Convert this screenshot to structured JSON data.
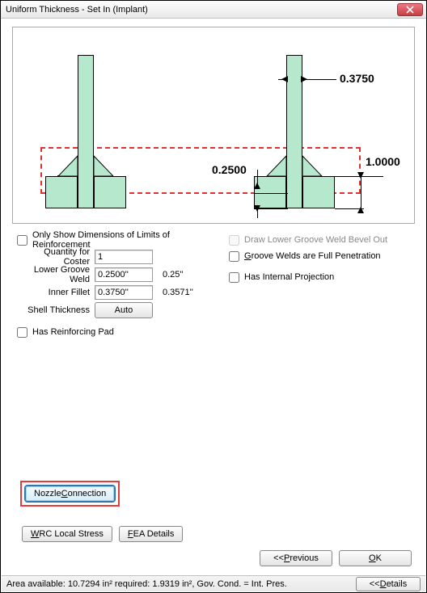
{
  "title": "Uniform Thickness - Set In (Implant)",
  "diagram": {
    "dim_top": "0.3750",
    "dim_right": "1.0000",
    "dim_mid": "0.2500"
  },
  "checkboxes": {
    "only_show_limits": "Only Show Dimensions of Limits of Reinforcement",
    "draw_lower_bevel": "Draw Lower Groove Weld Bevel Out",
    "groove_full_pen_pre": "G",
    "groove_full_pen_rest": "roove Welds are Full Penetration",
    "has_internal_proj": "Has Internal Projection",
    "has_reinforcing_pad": "Has Reinforcing Pad"
  },
  "fields": {
    "qty_label": "Quantity for Coster",
    "qty_value": "1",
    "lgw_label": "Lower Groove Weld",
    "lgw_value": "0.2500''",
    "lgw_hint": "0.25''",
    "if_label": "Inner Fillet",
    "if_value": "0.3750''",
    "if_hint": "0.3571''",
    "st_label": "Shell Thickness",
    "auto_label": "Auto"
  },
  "buttons": {
    "nozzle_pre": "Nozzle ",
    "nozzle_u": "C",
    "nozzle_rest": "onnection",
    "wrc_u": "W",
    "wrc_rest": "RC Local Stress",
    "fea_u": "F",
    "fea_rest": "EA Details",
    "prev_pre": "<<  ",
    "prev_u": "P",
    "prev_rest": "revious",
    "ok_u": "O",
    "ok_rest": "K",
    "details_pre": "<<  ",
    "details_u": "D",
    "details_rest": "etails"
  },
  "status": {
    "text": "Area available: 10.7294 in²    required: 1.9319 in², Gov. Cond. = Int. Pres."
  }
}
